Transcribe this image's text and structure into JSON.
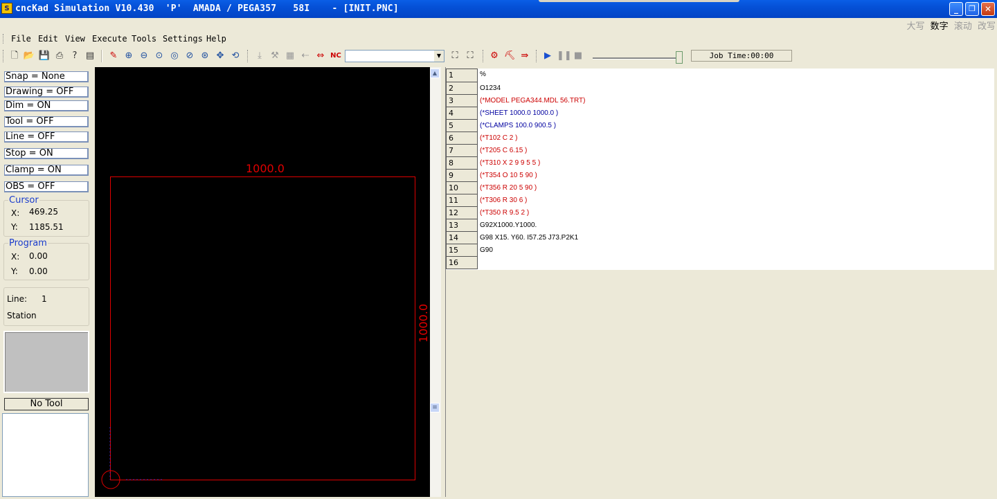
{
  "window": {
    "title": "cncKad Simulation V10.430  'P'  AMADA / PEGA357   58I    - [INIT.PNC]",
    "app_icon_text": "S",
    "buttons": {
      "minimize": "_",
      "maximize": "❐",
      "close": "✕"
    }
  },
  "ime": {
    "caps": "大写",
    "numlock": "数字",
    "scroll": "滚动",
    "overwrite": "改写"
  },
  "menu": [
    "File",
    "Edit",
    "View",
    "Execute",
    "Tools",
    "Settings",
    "Help"
  ],
  "toolbar": {
    "job_time": "Job Time:00:00",
    "combo_value": ""
  },
  "left_panel": {
    "toggles": [
      "Snap = None",
      "Drawing = OFF",
      "Dim  = ON",
      "Tool  = OFF",
      "Line  = OFF",
      "Stop  = ON",
      "Clamp = ON",
      "OBS  = OFF"
    ],
    "cursor": {
      "title": "Cursor",
      "x_label": "X:",
      "x_value": "469.25",
      "y_label": "Y:",
      "y_value": "1185.51"
    },
    "program": {
      "title": "Program",
      "x_label": "X:",
      "x_value": "0.00",
      "y_label": "Y:",
      "y_value": "0.00"
    },
    "status": {
      "line_label": "Line:",
      "line_value": "1",
      "station_label": "Station"
    },
    "no_tool_label": "No Tool"
  },
  "canvas": {
    "width_dim": "1000.0",
    "height_dim": "1000.0",
    "sheet_color": "#e00000"
  },
  "code_lines": [
    {
      "n": "1",
      "text": "%",
      "color": "#000000"
    },
    {
      "n": "2",
      "text": "O1234",
      "color": "#000000"
    },
    {
      "n": "3",
      "text": "(*MODEL PEGA344.MDL 56.TRT)",
      "color": "#cc0000"
    },
    {
      "n": "4",
      "text": "(*SHEET 1000.0 1000.0 )",
      "color": "#0000a0"
    },
    {
      "n": "5",
      "text": "(*CLAMPS 100.0 900.5 )",
      "color": "#0000a0"
    },
    {
      "n": "6",
      "text": "(*T102 C 2 )",
      "color": "#cc0000"
    },
    {
      "n": "7",
      "text": "(*T205 C 6.15 )",
      "color": "#cc0000"
    },
    {
      "n": "8",
      "text": "(*T310 X 2 9 9 5 5 )",
      "color": "#cc0000"
    },
    {
      "n": "9",
      "text": "(*T354 O 10 5 90 )",
      "color": "#cc0000"
    },
    {
      "n": "10",
      "text": "(*T356 R 20 5 90 )",
      "color": "#cc0000"
    },
    {
      "n": "11",
      "text": "(*T306 R 30 6 )",
      "color": "#cc0000"
    },
    {
      "n": "12",
      "text": "(*T350 R 9.5 2 )",
      "color": "#cc0000"
    },
    {
      "n": "13",
      "text": "G92X1000.Y1000.",
      "color": "#000000"
    },
    {
      "n": "14",
      "text": "G98 X15. Y60. I57.25 J73.P2K1",
      "color": "#000000"
    },
    {
      "n": "15",
      "text": "G90",
      "color": "#000000"
    },
    {
      "n": "16",
      "text": "",
      "color": "#000000"
    }
  ]
}
